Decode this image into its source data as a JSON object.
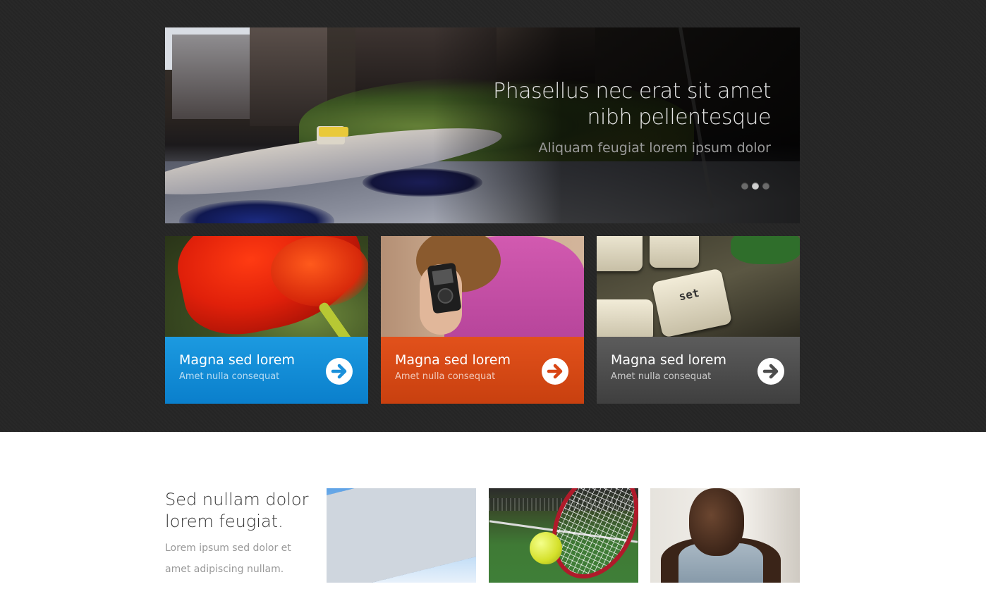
{
  "hero": {
    "title_line1": "Phasellus nec erat sit amet",
    "title_line2": "nibh pellentesque",
    "subtitle": "Aliquam feugiat lorem ipsum dolor",
    "slides": 3,
    "active_slide": 2
  },
  "cards": [
    {
      "title": "Magna sed lorem",
      "subtitle": "Amet nulla consequat",
      "color": "#1b90da",
      "image": "red-tulip"
    },
    {
      "title": "Magna sed lorem",
      "subtitle": "Amet nulla consequat",
      "color": "#d84514",
      "image": "woman-with-music-player"
    },
    {
      "title": "Magna sed lorem",
      "subtitle": "Amet nulla consequat",
      "color": "#4d4d4d",
      "image": "typewriter-keys"
    }
  ],
  "typewriter_key_label": "set",
  "section": {
    "title": "Sed nullam dolor lorem feugiat.",
    "text": "Lorem ipsum sed dolor et amet adipiscing nullam."
  },
  "thumbnails": [
    "office-building",
    "tennis-racket-ball",
    "man-portrait"
  ],
  "colors": {
    "dark_bg": "#262626",
    "blue": "#1b90da",
    "orange": "#d84514",
    "gray": "#4d4d4d"
  }
}
